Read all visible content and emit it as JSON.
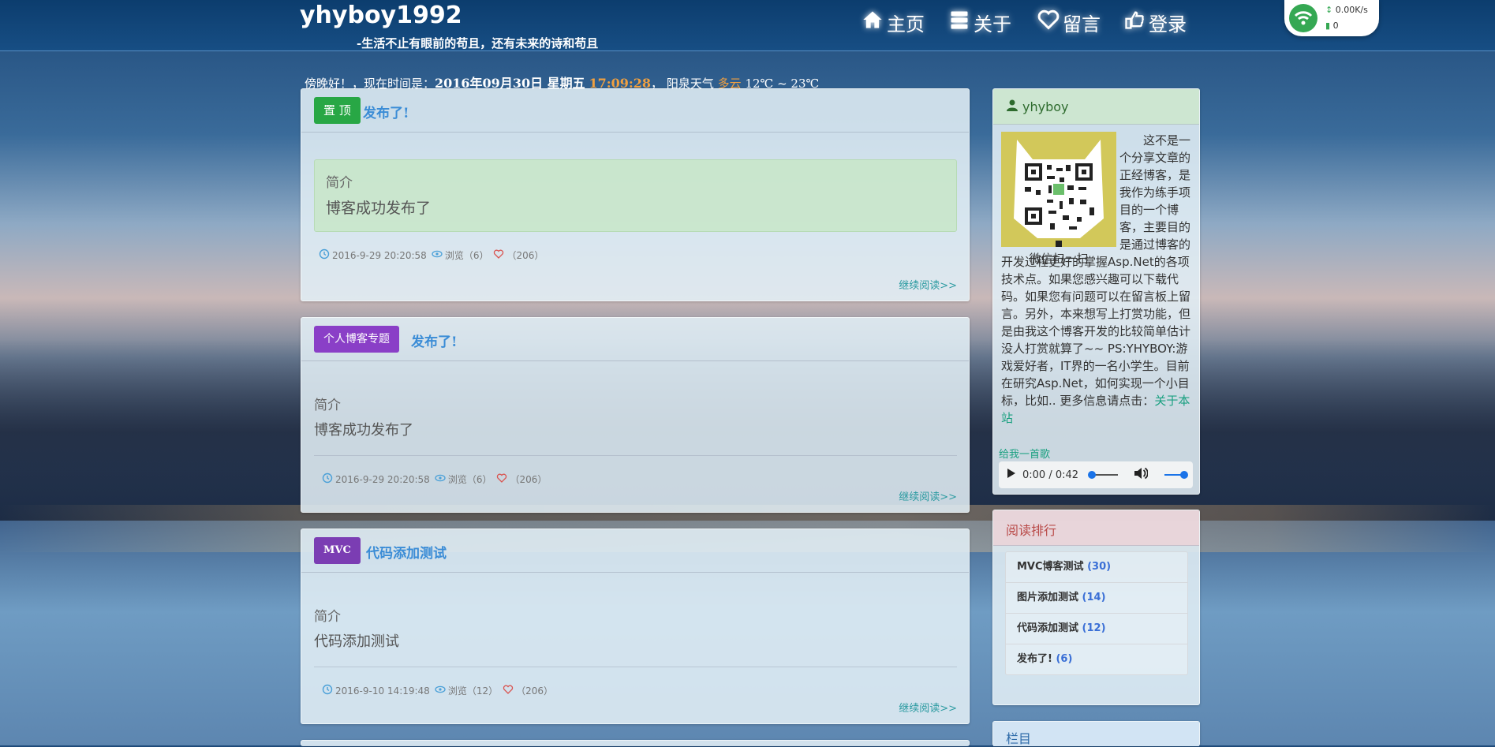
{
  "header": {
    "title": "yhyboy1992",
    "subtitle": "-生活不止有眼前的苟且，还有未来的诗和苟且",
    "nav": [
      {
        "label": "主页",
        "icon": "home-icon"
      },
      {
        "label": "关于",
        "icon": "list-icon"
      },
      {
        "label": "留言",
        "icon": "heart-icon"
      },
      {
        "label": "登录",
        "icon": "hand-icon"
      }
    ],
    "net_widget": {
      "speed": "0.00K/s",
      "count": "0"
    }
  },
  "greeting": {
    "prefix": "傍晚好！，现在时间是：",
    "date": "2016年09月30日 星期五",
    "time": "17:09:28",
    "sep": "，",
    "city": "阳泉天气",
    "weather": "多云",
    "temp": "12℃ ~ 23℃"
  },
  "posts": [
    {
      "tag": "置 顶",
      "title": "发布了!",
      "summary_label": "简介",
      "summary_text": "博客成功发布了",
      "date": "2016-9-29 20:20:58",
      "views": "浏览（6）",
      "likes": "（206）",
      "read_more": "继续阅读>>"
    },
    {
      "tag": "个人博客专题",
      "title": "发布了!",
      "summary_label": "简介",
      "summary_text": "博客成功发布了",
      "date": "2016-9-29 20:20:58",
      "views": "浏览（6）",
      "likes": "（206）",
      "read_more": "继续阅读>>"
    },
    {
      "tag": "MVC",
      "title": "代码添加测试",
      "summary_label": "简介",
      "summary_text": "代码添加测试",
      "date": "2016-9-10 14:19:48",
      "views": "浏览（12）",
      "likes": "（206）",
      "read_more": "继续阅读>>"
    }
  ],
  "profile": {
    "name": "yhyboy",
    "qr_caption": "微信扫一扫",
    "intro": "这不是一个分享文章的正经博客，是我作为练手项目的一个博客，主要目的是通过博客的开发过程更好的掌握Asp.Net的各项技术点。如果您感兴趣可以下载代码。如果您有问题可以在留言板上留言。另外，本来想写上打赏功能，但是由我这个博客开发的比较简单估计没人打赏就算了~~ PS:YHYBOY:游戏爱好者，IT界的一名小学生。目前在研究Asp.Net，如何实现一个小目标，比如.. 更多信息请点击：",
    "intro_link": "关于本站",
    "song_link": "给我一首歌",
    "audio_time": "0:00 / 0:42"
  },
  "ranking": {
    "title": "阅读排行",
    "items": [
      {
        "name": "MVC博客测试",
        "count": "(30)"
      },
      {
        "name": "图片添加测试",
        "count": "(14)"
      },
      {
        "name": "代码添加测试",
        "count": "(12)"
      },
      {
        "name": "发布了!",
        "count": "(6)"
      }
    ]
  },
  "column": {
    "title": "栏目"
  },
  "colors": {
    "accent_blue": "#3a8cd6",
    "orange": "#f0a040",
    "green_tag": "#28a745",
    "purple_tag": "#8a3fc7"
  }
}
